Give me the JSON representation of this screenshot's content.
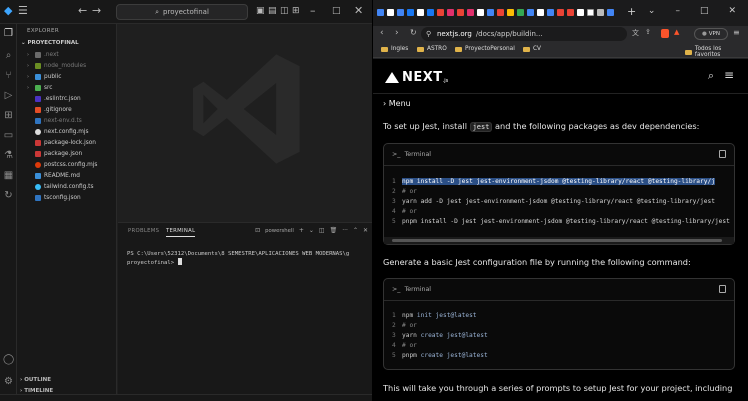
{
  "vscode": {
    "search_text": "proyectofinal",
    "explorer_header": "EXPLORER",
    "project_name": "PROYECTOFINAL",
    "tree": [
      {
        "label": ".next",
        "type": "folder",
        "color": "#7a7a7a"
      },
      {
        "label": "node_modules",
        "type": "folder",
        "color": "#7a7a7a"
      },
      {
        "label": "public",
        "type": "folder",
        "color": "#ccc"
      },
      {
        "label": "src",
        "type": "folder",
        "color": "#ccc"
      },
      {
        "label": ".eslintrc.json",
        "type": "file",
        "color": "#ccc"
      },
      {
        "label": ".gitignore",
        "type": "file",
        "color": "#ccc"
      },
      {
        "label": "next-env.d.ts",
        "type": "file",
        "color": "#7a7a7a"
      },
      {
        "label": "next.config.mjs",
        "type": "file",
        "color": "#ccc"
      },
      {
        "label": "package-lock.json",
        "type": "file",
        "color": "#ccc"
      },
      {
        "label": "package.json",
        "type": "file",
        "color": "#ccc"
      },
      {
        "label": "postcss.config.mjs",
        "type": "file",
        "color": "#ccc"
      },
      {
        "label": "README.md",
        "type": "file",
        "color": "#ccc"
      },
      {
        "label": "tailwind.config.ts",
        "type": "file",
        "color": "#ccc"
      },
      {
        "label": "tsconfig.json",
        "type": "file",
        "color": "#ccc"
      }
    ],
    "outline_label": "OUTLINE",
    "timeline_label": "TIMELINE",
    "panel_tabs": [
      "PROBLEMS",
      "TERMINAL"
    ],
    "shell_label": "powershell",
    "terminal_line1": "PS C:\\Users\\52312\\Documents\\8 SEMESTRE\\APLICACIONES WEB MODERNAS\\g",
    "terminal_line2": "proyectofinal> "
  },
  "browser": {
    "url_host": "nextjs.org",
    "url_path": "/docs/app/buildin...",
    "vpn_label": "VPN",
    "bookmarks": [
      "Ingles",
      "ASTRO",
      "ProyectoPersonal",
      "CV"
    ],
    "all_bookmarks": "Todos los favoritos",
    "page": {
      "logo_text": "NEXT",
      "logo_suffix": ".js",
      "menu_label": "Menu",
      "para1_before": "To set up Jest, install ",
      "para1_code": "jest",
      "para1_after": " and the following packages as dev dependencies:",
      "terminal_label": "Terminal",
      "install_lines": [
        {
          "n": "1",
          "cmd": "npm",
          "rest": " install -D jest jest-environment-jsdom @testing-library/react @testing-library/j"
        },
        {
          "n": "2",
          "cmd": "# or",
          "rest": ""
        },
        {
          "n": "3",
          "cmd": "yarn",
          "rest": " add -D jest jest-environment-jsdom @testing-library/react @testing-library/jest"
        },
        {
          "n": "4",
          "cmd": "# or",
          "rest": ""
        },
        {
          "n": "5",
          "cmd": "pnpm",
          "rest": " install -D jest jest-environment-jsdom @testing-library/react @testing-library/jest"
        }
      ],
      "para2": "Generate a basic Jest configuration file by running the following command:",
      "init_lines": [
        {
          "n": "1",
          "cmd": "npm",
          "rest": " init jest@latest"
        },
        {
          "n": "2",
          "cmd": "# or",
          "rest": ""
        },
        {
          "n": "3",
          "cmd": "yarn",
          "rest": " create jest@latest"
        },
        {
          "n": "4",
          "cmd": "# or",
          "rest": ""
        },
        {
          "n": "5",
          "cmd": "pnpm",
          "rest": " create jest@latest"
        }
      ],
      "para3": "This will take you through a series of prompts to setup Jest for your project, including"
    }
  }
}
